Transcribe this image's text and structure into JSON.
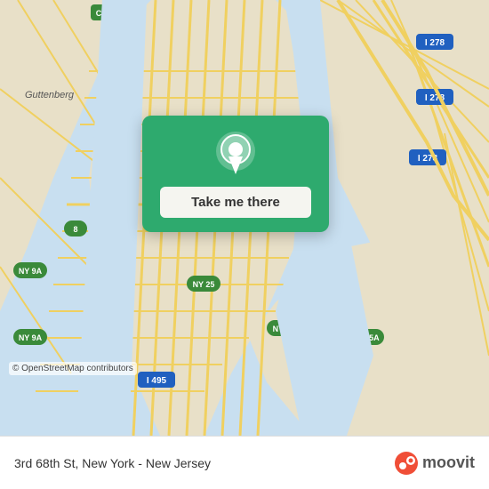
{
  "map": {
    "background_color": "#e8e0d8",
    "copyright": "© OpenStreetMap contributors"
  },
  "action_card": {
    "button_label": "Take me there",
    "pin_icon": "location-pin-icon"
  },
  "bottom_bar": {
    "location_text": "3rd 68th St, New York - New Jersey",
    "brand_name": "moovit"
  }
}
